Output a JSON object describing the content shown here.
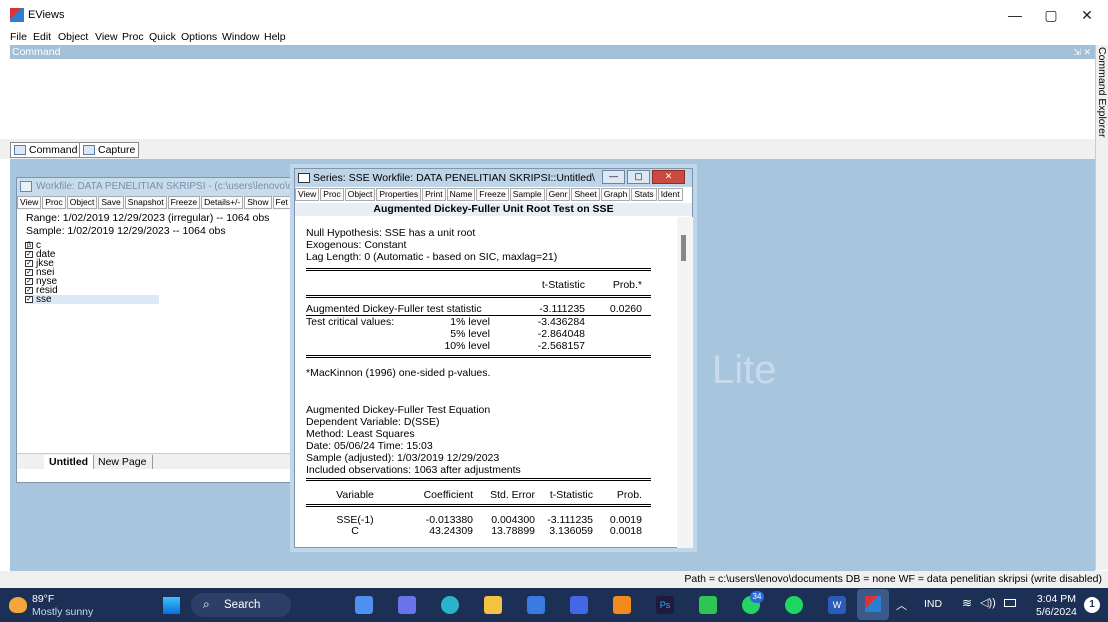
{
  "app": {
    "title": "EViews",
    "minimize": "—",
    "restore": "▢",
    "close": "✕"
  },
  "menu": [
    "File",
    "Edit",
    "Object",
    "View",
    "Proc",
    "Quick",
    "Options",
    "Window",
    "Help"
  ],
  "command": {
    "header": "Command",
    "pin": "⇲ ✕",
    "tabs": [
      "Command",
      "Capture"
    ],
    "explorer": "Command Explorer"
  },
  "workfile": {
    "title": "Workfile: DATA PENELITIAN SKRIPSI - (c:\\users\\lenovo\\d",
    "toolbar": [
      "View",
      "Proc",
      "Object",
      "Save",
      "Snapshot",
      "Freeze",
      "Details+/-",
      "Show",
      "Fet"
    ],
    "range": "Range:  1/02/2019 12/29/2023 (irregular)  --  1064 obs",
    "sample": "Sample: 1/02/2019 12/29/2023  --  1064 obs",
    "objects": [
      {
        "name": "c",
        "icon": "β"
      },
      {
        "name": "date",
        "icon": "✓"
      },
      {
        "name": "jkse",
        "icon": "✓"
      },
      {
        "name": "nsei",
        "icon": "✓"
      },
      {
        "name": "nyse",
        "icon": "✓"
      },
      {
        "name": "resid",
        "icon": "✓"
      },
      {
        "name": "sse",
        "icon": "✓"
      }
    ],
    "tabs": [
      "Untitled",
      "New Page"
    ]
  },
  "series": {
    "title": "Series: SSE   Workfile: DATA PENELITIAN SKRIPSI::Untitled\\",
    "toolbar": [
      "View",
      "Proc",
      "Object",
      "Properties",
      "Print",
      "Name",
      "Freeze",
      "Sample",
      "Genr",
      "Sheet",
      "Graph",
      "Stats",
      "Ident"
    ],
    "header": "Augmented Dickey-Fuller Unit Root Test on SSE",
    "null_hyp": "Null Hypothesis: SSE has a unit root",
    "exog": "Exogenous: Constant",
    "lag": "Lag Length: 0 (Automatic - based on SIC, maxlag=21)",
    "col_t": "t-Statistic",
    "col_p": "Prob.*",
    "adf_label": "Augmented Dickey-Fuller test statistic",
    "adf_t": "-3.111235",
    "adf_p": "0.0260",
    "crit_label": "Test critical values:",
    "crit": [
      {
        "level": "1% level",
        "value": "-3.436284"
      },
      {
        "level": "5% level",
        "value": "-2.864048"
      },
      {
        "level": "10% level",
        "value": "-2.568157"
      }
    ],
    "note": "*MacKinnon (1996) one-sided p-values.",
    "eq_title": "Augmented Dickey-Fuller Test Equation",
    "dep": "Dependent Variable: D(SSE)",
    "method": "Method: Least Squares",
    "date": "Date: 05/06/24   Time: 15:03",
    "sample_adj": "Sample (adjusted): 1/03/2019 12/29/2023",
    "obs": "Included observations: 1063 after adjustments",
    "reg_headers": [
      "Variable",
      "Coefficient",
      "Std. Error",
      "t-Statistic",
      "Prob."
    ],
    "reg_rows": [
      [
        "SSE(-1)",
        "-0.013380",
        "0.004300",
        "-3.111235",
        "0.0019"
      ],
      [
        "C",
        "43.24309",
        "13.78899",
        "3.136059",
        "0.0018"
      ]
    ]
  },
  "watermark": "Lite",
  "status": "Path = c:\\users\\lenovo\\documents   DB = none   WF = data penelitian skripsi (write disabled)",
  "taskbar": {
    "temp": "89°F",
    "weather": "Mostly sunny",
    "search": "Search",
    "lang": "IND",
    "time": "3:04 PM",
    "date": "5/6/2024",
    "notif": "1",
    "badge": "34"
  },
  "colors": {
    "desktop": "#a8c5de",
    "taskbar": "#1c2f55",
    "titlebar_active": "#bed4e9"
  }
}
